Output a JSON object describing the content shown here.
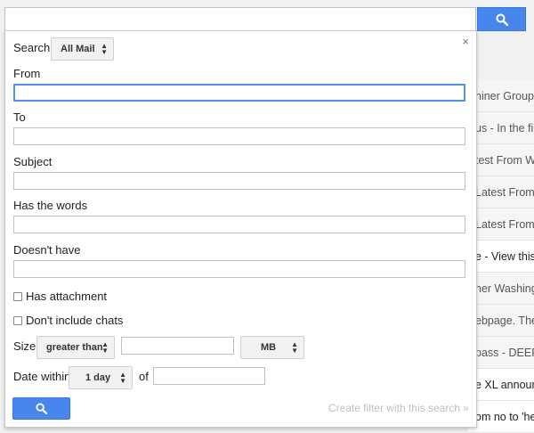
{
  "search_box": {
    "value": ""
  },
  "background_emails": [
    {
      "text": "niner Group/",
      "unread": false
    },
    {
      "text": "us - In the fir",
      "unread": false
    },
    {
      "text": "test From W",
      "unread": false
    },
    {
      "text": "Latest From",
      "unread": false
    },
    {
      "text": "Latest From",
      "unread": false
    },
    {
      "text": "e - View this",
      "unread": true
    },
    {
      "text": "ner Washing",
      "unread": false
    },
    {
      "text": "ebpage. The",
      "unread": false
    },
    {
      "text": "pass - DEEP",
      "unread": false
    },
    {
      "text": "e XL annour",
      "unread": true
    },
    {
      "text": "om no to 'he",
      "unread": true
    }
  ],
  "panel": {
    "close": "×",
    "search_label": "Search",
    "search_scope": "All Mail",
    "from_label": "From",
    "from_value": "",
    "to_label": "To",
    "to_value": "",
    "subject_label": "Subject",
    "subject_value": "",
    "has_words_label": "Has the words",
    "has_words_value": "",
    "doesnt_have_label": "Doesn't have",
    "doesnt_have_value": "",
    "has_attachment_label": "Has attachment",
    "no_chats_label": "Don't include chats",
    "size_label": "Size",
    "size_operator": "greater than",
    "size_value": "",
    "size_unit": "MB",
    "date_label": "Date within",
    "date_range": "1 day",
    "of_label": "of",
    "date_value": "",
    "create_filter": "Create filter with this search »"
  },
  "icons": {
    "search": "search-icon",
    "close": "close-icon"
  },
  "colors": {
    "accent": "#4787ed",
    "focus": "#4d90fe"
  }
}
